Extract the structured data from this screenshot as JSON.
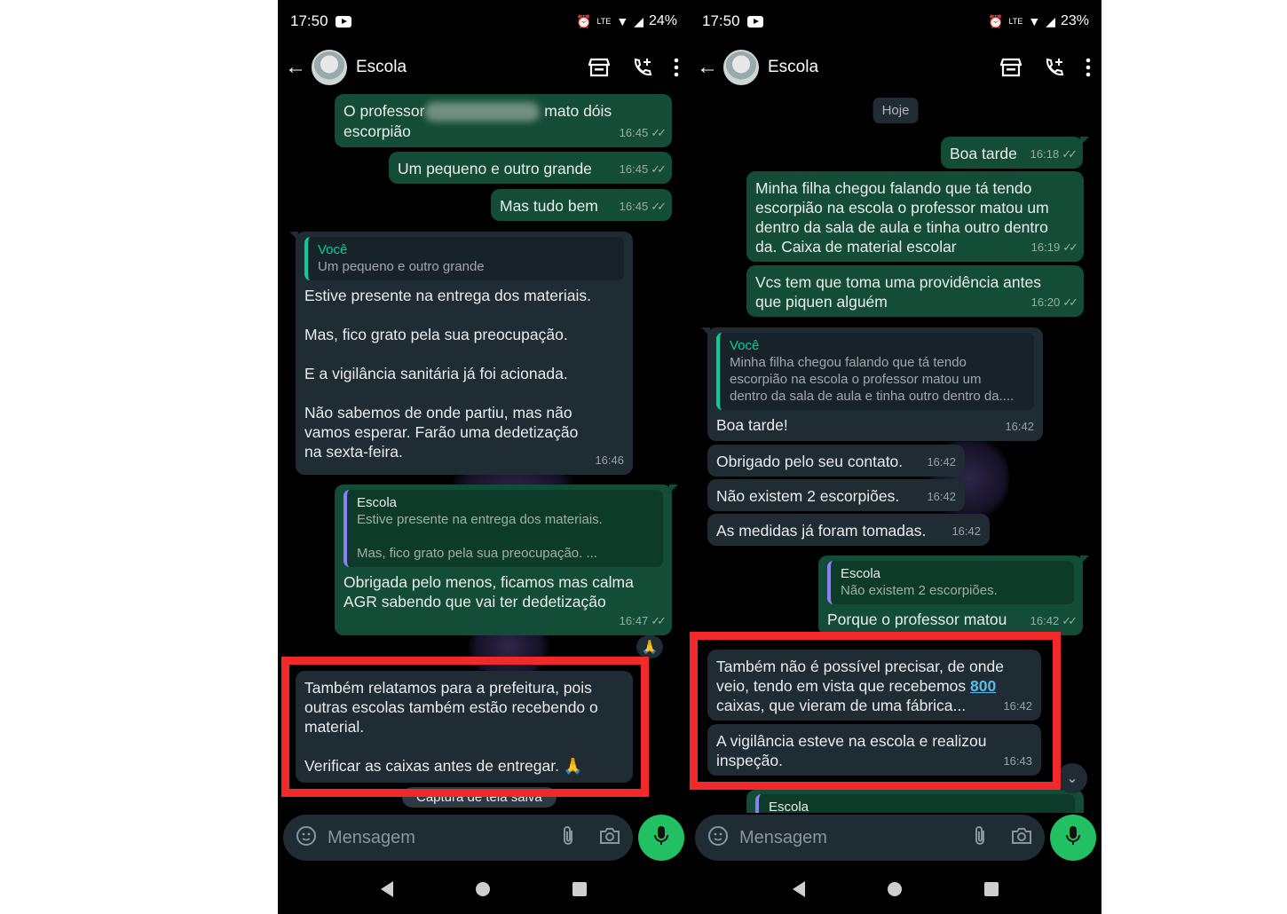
{
  "left": {
    "status": {
      "time": "17:50",
      "battery": "24%",
      "network": "LTE"
    },
    "appbar": {
      "title": "Escola"
    },
    "messages": {
      "m1_pre": "O professor",
      "m1_post": " mato dóis\nescorpião",
      "m1_time": "16:45",
      "m2": "Um pequeno e outro grande",
      "m2_time": "16:45",
      "m3": "Mas tudo bem",
      "m3_time": "16:45",
      "m4_quote_author": "Você",
      "m4_quote_text": "Um pequeno e outro grande",
      "m4": "Estive presente na entrega dos materiais.\n\nMas, fico grato pela sua preocupação.\n\nE a vigilância sanitária já foi acionada.\n\nNão sabemos de onde partiu, mas não\nvamos esperar.     Farão uma dedetização\nna sexta-feira.",
      "m4_time": "16:46",
      "m5_quote_author": "Escola",
      "m5_quote_text": "Estive presente na entrega dos materiais.\n\nMas, fico grato pela sua preocupação. ...",
      "m5": "Obrigada pelo menos, ficamos mas calma\nAGR sabendo que vai ter dedetização",
      "m5_time": "16:47",
      "m5_reaction": "🙏",
      "m6": "Também relatamos para a prefeitura, pois\noutras escolas também estão recebendo o\nmaterial.\n\nVerificar as caixas antes de entregar. 🙏"
    },
    "toast": "Captura de tela salva",
    "input_placeholder": "Mensagem"
  },
  "right": {
    "status": {
      "time": "17:50",
      "battery": "23%",
      "network": "LTE"
    },
    "appbar": {
      "title": "Escola"
    },
    "date_chip": "Hoje",
    "messages": {
      "r1": "Boa tarde",
      "r1_time": "16:18",
      "r2": "Minha filha chegou falando que tá tendo\nescorpião na escola o professor matou um\ndentro da sala de aula e tinha outro dentro\nda. Caixa de material escolar",
      "r2_time": "16:19",
      "r3": "Vcs tem que toma uma providência antes\nque piquen alguém",
      "r3_time": "16:20",
      "r4_quote_author": "Você",
      "r4_quote_text": "Minha filha chegou falando que tá tendo\nescorpião na escola o professor matou um\ndentro da sala de aula e tinha outro dentro da....",
      "r4": "Boa tarde!",
      "r4_time": "16:42",
      "r5": "Obrigado pelo seu contato.",
      "r5_time": "16:42",
      "r6": "Não existem 2 escorpiões.",
      "r6_time": "16:42",
      "r7": "As medidas já foram tomadas.",
      "r7_time": "16:42",
      "r8_quote_author": "Escola",
      "r8_quote_text": "Não existem 2 escorpiões.",
      "r8": "Porque o professor matou",
      "r8_time": "16:42",
      "r9_pre": "Também não é possível precisar, de onde\nveio, tendo em vista que recebemos ",
      "r9_link": "800",
      "r9_post": "\ncaixas, que vieram de uma fábrica...",
      "r9_time": "16:42",
      "r10": "A vigilância esteve na escola e realizou\ninspeção.",
      "r10_time": "16:43",
      "r11_quote_author": "Escola"
    },
    "input_placeholder": "Mensagem"
  },
  "colors": {
    "outgoing_bubble": "#144d37",
    "incoming_bubble": "#1f2c34",
    "accent_green": "#21c063",
    "highlight_red": "#f2292b"
  },
  "icons": [
    "back-arrow-icon",
    "store-icon",
    "add-call-icon",
    "more-vert-icon",
    "double-check-icon",
    "sticker-icon",
    "attach-icon",
    "camera-icon",
    "mic-icon",
    "chevron-down-icon"
  ]
}
